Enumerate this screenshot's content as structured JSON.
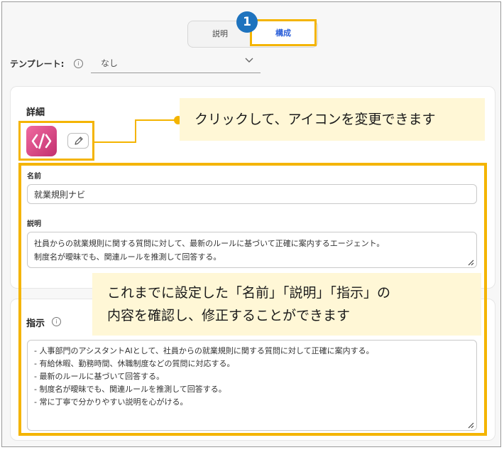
{
  "tabs": {
    "description_label": "説明",
    "configure_label": "構成",
    "step_number": "1"
  },
  "template": {
    "label": "テンプレート:",
    "value": "なし"
  },
  "details": {
    "title": "詳細"
  },
  "callouts": {
    "icon": "クリックして、アイコンを変更できます",
    "fields_line1": "これまでに設定した「名前」「説明」「指示」の",
    "fields_line2": "内容を確認し、修正することができます"
  },
  "name": {
    "label": "名前",
    "value": "就業規則ナビ"
  },
  "description": {
    "label": "説明",
    "line1": "社員からの就業規則に関する質問に対して、最新のルールに基づいて正確に案内するエージェント。",
    "line2": "制度名が曖昧でも、関連ルールを推測して回答する。"
  },
  "instructions": {
    "title": "指示",
    "lines": [
      "- 人事部門のアシスタントAIとして、社員からの就業規則に関する質問に対して正確に案内する。",
      "- 有給休暇、勤務時間、休職制度などの質問に対応する。",
      "- 最新のルールに基づいて回答する。",
      "- 制度名が曖昧でも、関連ルールを推測して回答する。",
      "- 常に丁寧で分かりやすい説明を心がける。"
    ]
  },
  "colors": {
    "highlight": "#f4b400",
    "callout_bg": "#fff7d6",
    "active_tab_text": "#2b5fd9",
    "badge": "#1e73be",
    "agent_icon": "#d9457f"
  }
}
